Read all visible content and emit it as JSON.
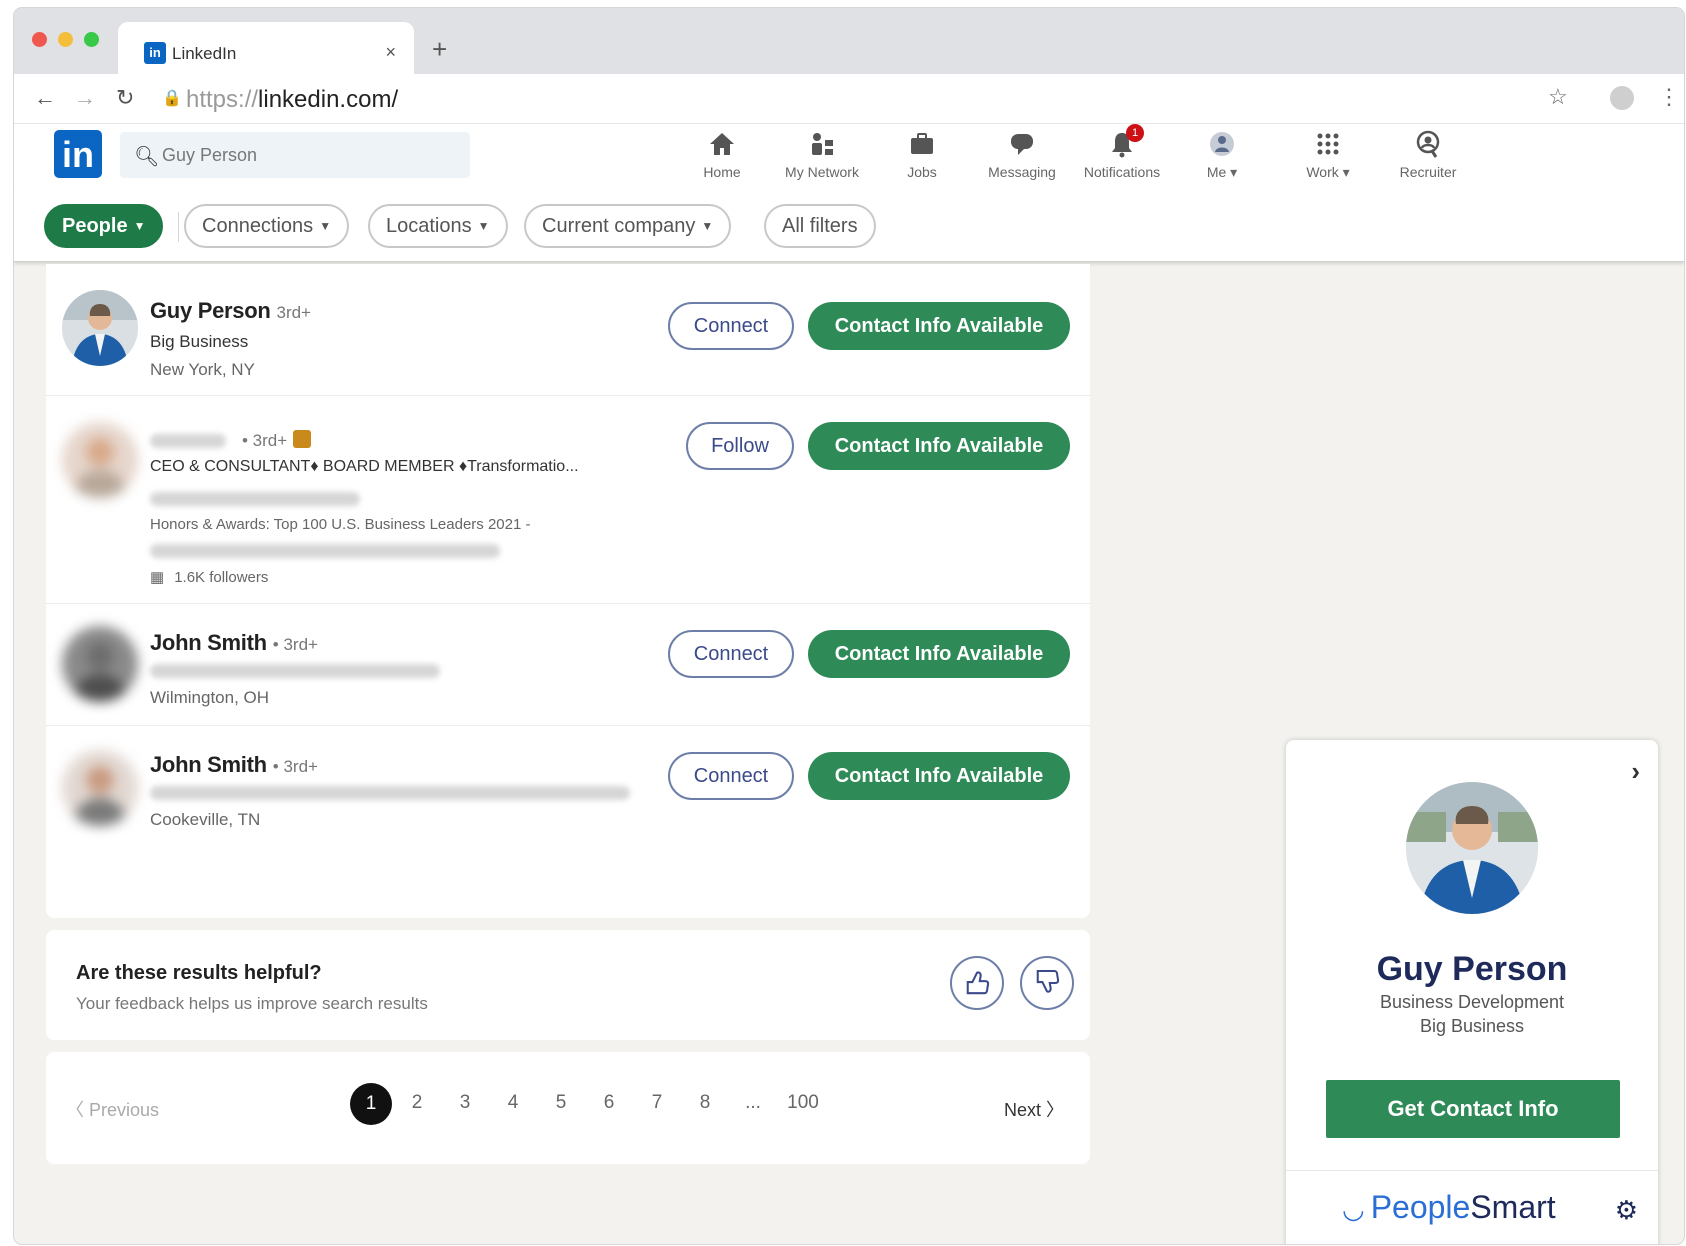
{
  "browser": {
    "tab_title": "LinkedIn",
    "tab_favicon": "in",
    "tab_close": "×",
    "new_tab": "+",
    "url_scheme": "https://",
    "url_host": "linkedin.com/"
  },
  "linkedin": {
    "logo": "in",
    "search": {
      "value": "Guy Person",
      "placeholder": "Search"
    },
    "nav": [
      {
        "label": "Home",
        "icon": "home-icon"
      },
      {
        "label": "My Network",
        "icon": "network-icon"
      },
      {
        "label": "Jobs",
        "icon": "briefcase-icon"
      },
      {
        "label": "Messaging",
        "icon": "chat-icon"
      },
      {
        "label": "Notifications",
        "icon": "bell-icon",
        "badge": "1"
      },
      {
        "label": "Me ▾",
        "icon": "avatar-icon"
      },
      {
        "label": "Work ▾",
        "icon": "grid-icon"
      },
      {
        "label": "Recruiter",
        "icon": "recruiter-icon"
      }
    ],
    "filters": [
      {
        "label": "People",
        "active": true
      },
      {
        "label": "Connections"
      },
      {
        "label": "Locations"
      },
      {
        "label": "Current company"
      },
      {
        "label": "All filters"
      }
    ]
  },
  "results": [
    {
      "name": "Guy Person",
      "degree": "3rd+",
      "headline": "Big Business",
      "location": "New York, NY",
      "action": "Connect",
      "contact": "Contact Info Available"
    },
    {
      "name": "",
      "degree": "• 3rd+",
      "headline": "CEO & CONSULTANT♦ BOARD MEMBER ♦Transformatio...",
      "awards": "Honors & Awards: Top 100 U.S. Business Leaders 2021 -",
      "followers": "1.6K followers",
      "action": "Follow",
      "contact": "Contact Info Available"
    },
    {
      "name": "John Smith",
      "degree": "• 3rd+",
      "location": "Wilmington, OH",
      "action": "Connect",
      "contact": "Contact Info Available"
    },
    {
      "name": "John Smith",
      "degree": "• 3rd+",
      "location": "Cookeville, TN",
      "action": "Connect",
      "contact": "Contact Info Available"
    }
  ],
  "feedback": {
    "question": "Are these results helpful?",
    "subtitle": "Your feedback helps us improve search results"
  },
  "pagination": {
    "previous": "Previous",
    "next": "Next",
    "pages": [
      "1",
      "2",
      "3",
      "4",
      "5",
      "6",
      "7",
      "8",
      "...",
      "100"
    ],
    "current": "1"
  },
  "peoplesmart": {
    "name": "Guy Person",
    "title": "Business Development",
    "company": "Big Business",
    "button": "Get Contact Info",
    "brand_a": "People",
    "brand_b": "Smart"
  },
  "colors": {
    "linkedin_blue": "#0a66c2",
    "green": "#2e8b57",
    "navy": "#1e2a5a"
  }
}
